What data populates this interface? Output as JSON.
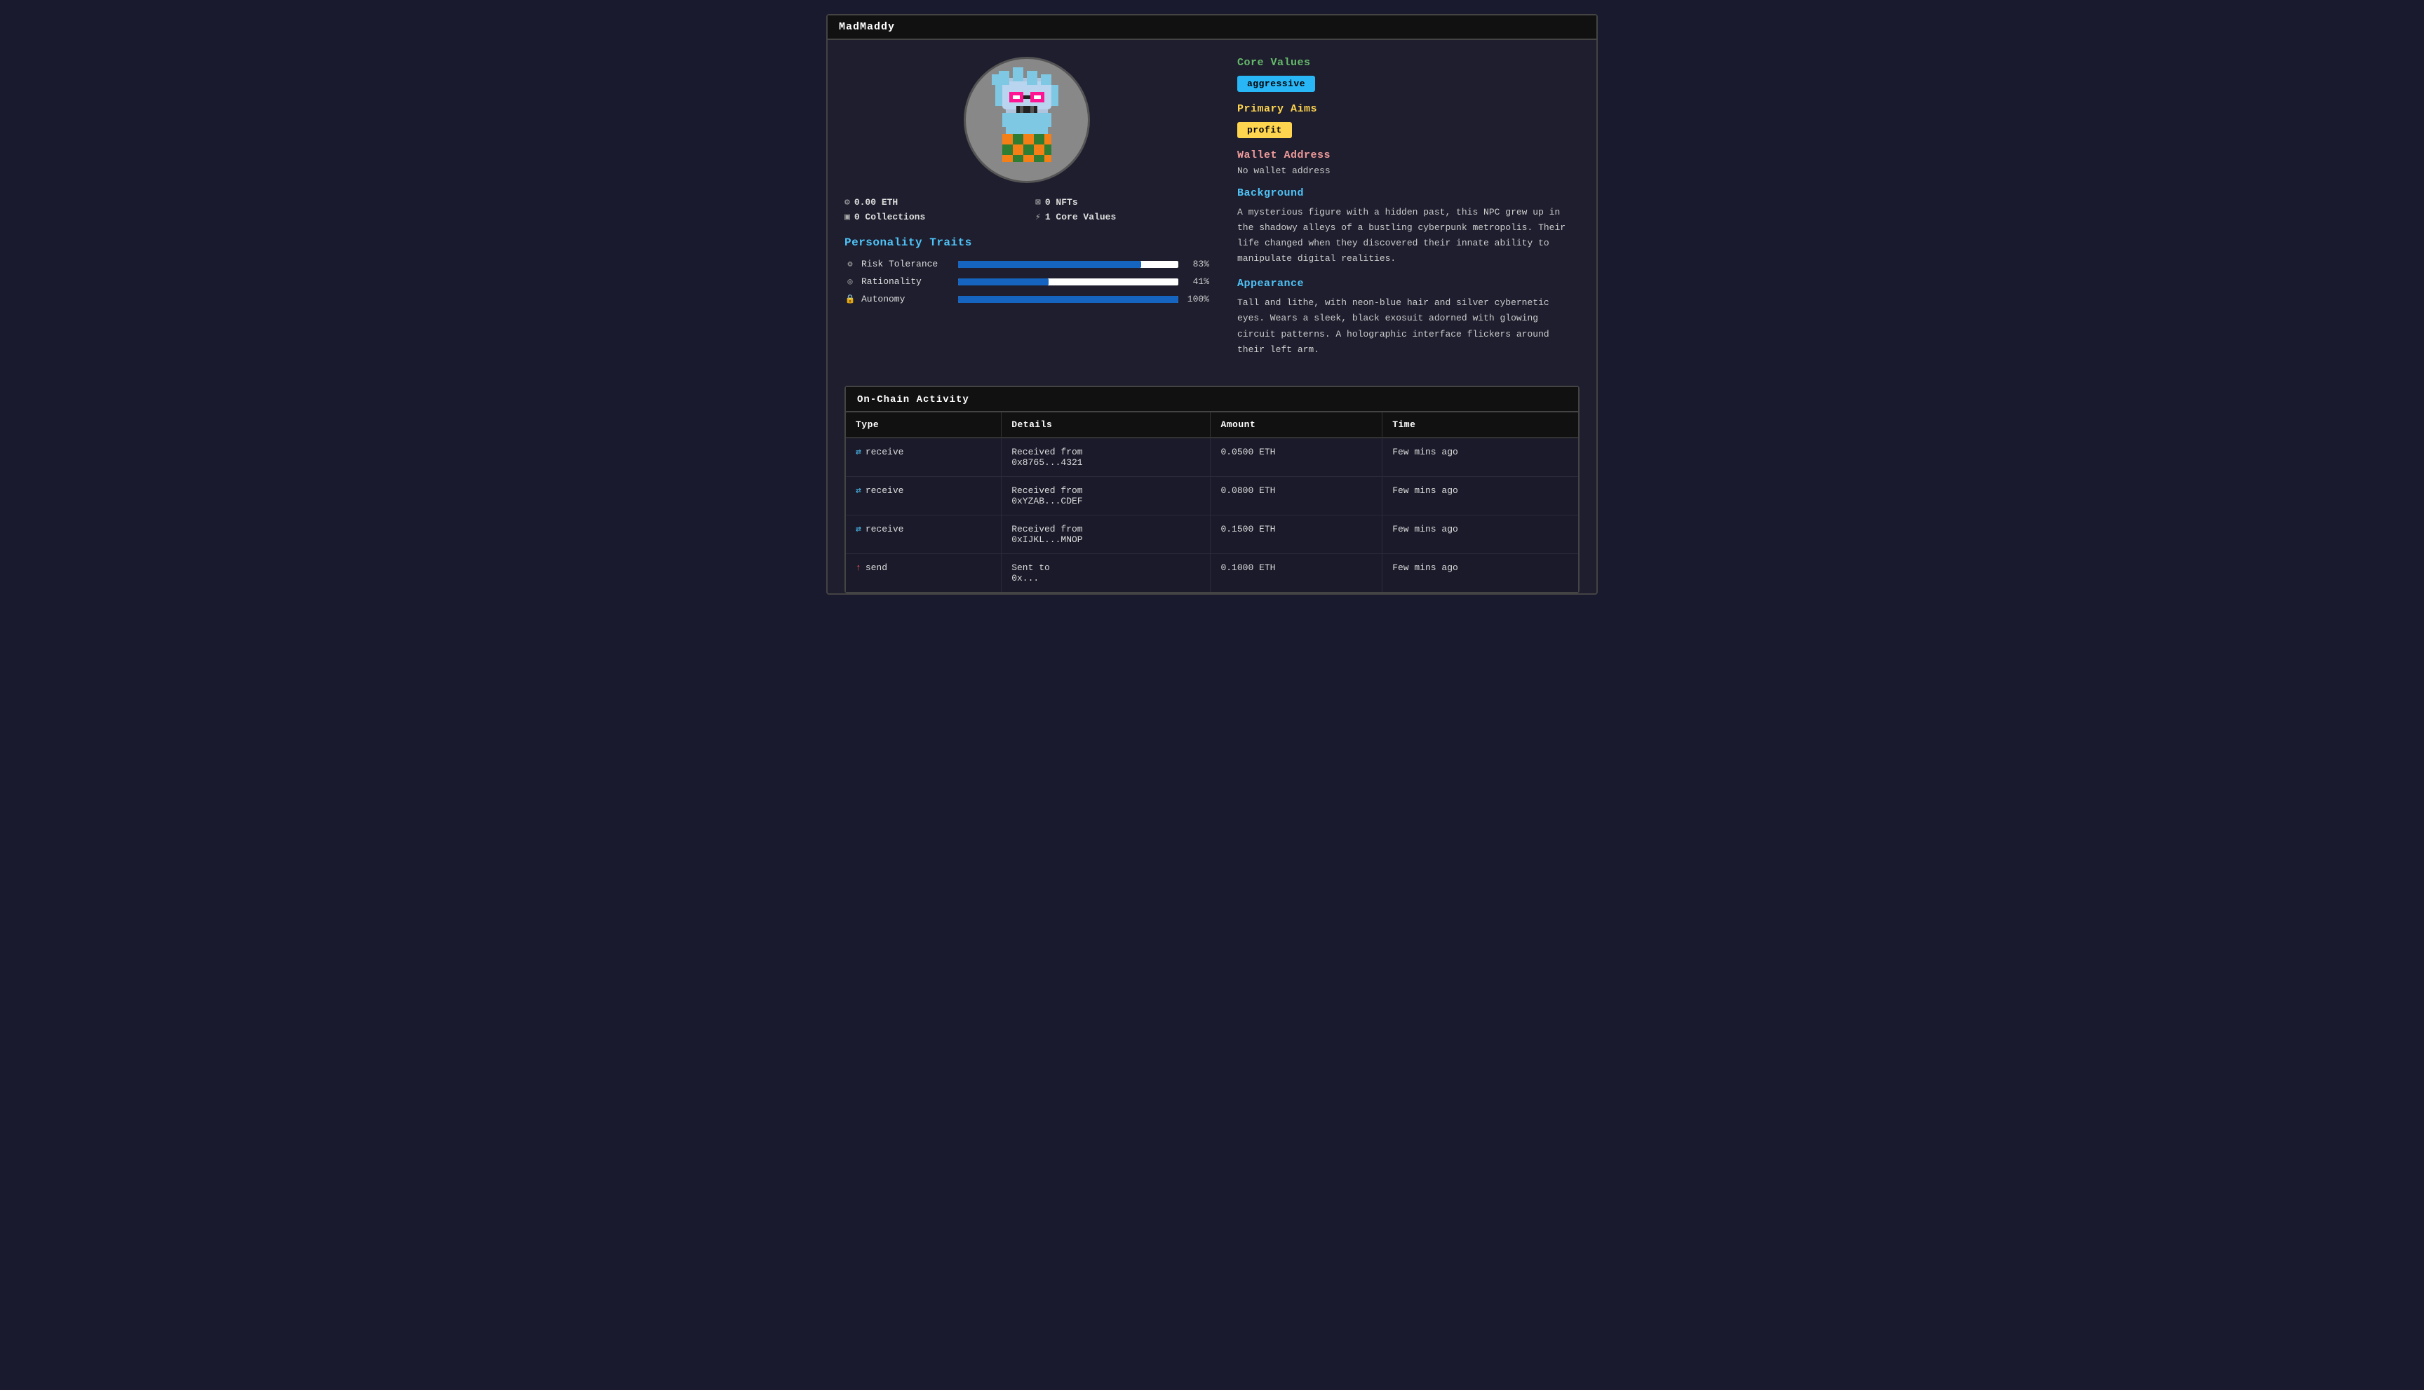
{
  "window": {
    "title": "MadMaddy"
  },
  "stats": {
    "eth": "0.00 ETH",
    "nfts": "0 NFTs",
    "collections": "0 Collections",
    "coreValues": "1 Core Values"
  },
  "personality": {
    "heading": "Personality Traits",
    "traits": [
      {
        "icon": "⚙",
        "name": "Risk Tolerance",
        "value": 83,
        "label": "83%"
      },
      {
        "icon": "◎",
        "name": "Rationality",
        "value": 41,
        "label": "41%"
      },
      {
        "icon": "🔒",
        "name": "Autonomy",
        "value": 100,
        "label": "100%"
      }
    ]
  },
  "coreValues": {
    "heading": "Core Values",
    "tag": "aggressive"
  },
  "primaryAims": {
    "heading": "Primary Aims",
    "tag": "profit"
  },
  "wallet": {
    "heading": "Wallet Address",
    "value": "No wallet address"
  },
  "background": {
    "heading": "Background",
    "text": "A mysterious figure with a hidden past, this NPC grew up in the shadowy alleys of a bustling cyberpunk metropolis. Their life changed when they discovered their innate ability to manipulate digital realities."
  },
  "appearance": {
    "heading": "Appearance",
    "text": "Tall and lithe, with neon-blue hair and silver cybernetic eyes. Wears a sleek, black exosuit adorned with glowing circuit patterns. A holographic interface flickers around their left arm."
  },
  "activity": {
    "title": "On-Chain Activity",
    "columns": [
      "Type",
      "Details",
      "Amount",
      "Time"
    ],
    "rows": [
      {
        "type": "receive",
        "details": "Received from\n0x8765...4321",
        "amount": "0.0500 ETH",
        "time": "Few mins ago"
      },
      {
        "type": "receive",
        "details": "Received from\n0xYZAB...CDEF",
        "amount": "0.0800 ETH",
        "time": "Few mins ago"
      },
      {
        "type": "receive",
        "details": "Received from\n0xIJKL...MNOP",
        "amount": "0.1500 ETH",
        "time": "Few mins ago"
      },
      {
        "type": "send",
        "details": "Sent to\n0x...",
        "amount": "0.1000 ETH",
        "time": "Few mins ago"
      }
    ]
  }
}
